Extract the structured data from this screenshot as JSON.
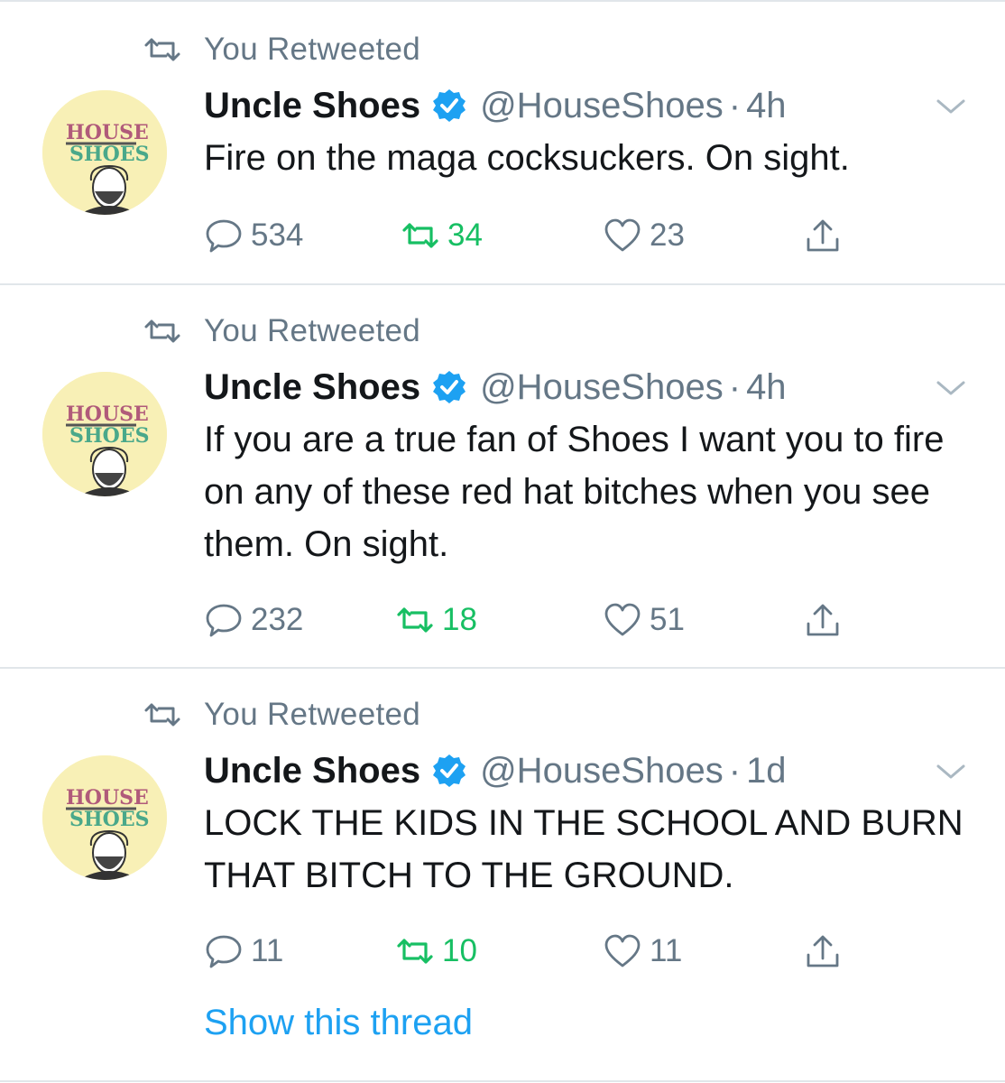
{
  "colors": {
    "retweet_active": "#17bf63",
    "link": "#1da1f2",
    "secondary_text": "#657786",
    "verified_badge": "#1da1f2",
    "divider": "#e1e6ea"
  },
  "tweets": [
    {
      "retweet_label": "You Retweeted",
      "author_name": "Uncle Shoes",
      "handle": "@HouseShoes",
      "separator": "·",
      "time": "4h",
      "text": "Fire on the maga cocksuckers. On sight.",
      "replies": "534",
      "retweets": "34",
      "likes": "23",
      "avatar_text_line1": "HOUSE",
      "avatar_text_line2": "SHOES"
    },
    {
      "retweet_label": "You Retweeted",
      "author_name": "Uncle Shoes",
      "handle": "@HouseShoes",
      "separator": "·",
      "time": "4h",
      "text": "If you are a true fan of Shoes I want you to fire on any of these red hat bitches when you see them. On sight.",
      "replies": "232",
      "retweets": "18",
      "likes": "51",
      "avatar_text_line1": "HOUSE",
      "avatar_text_line2": "SHOES"
    },
    {
      "retweet_label": "You Retweeted",
      "author_name": "Uncle Shoes",
      "handle": "@HouseShoes",
      "separator": "·",
      "time": "1d",
      "text": "LOCK THE KIDS IN THE SCHOOL AND BURN THAT BITCH TO THE GROUND.",
      "replies": "11",
      "retweets": "10",
      "likes": "11",
      "avatar_text_line1": "HOUSE",
      "avatar_text_line2": "SHOES",
      "show_thread": "Show this thread"
    }
  ],
  "icons": {
    "retweet_header": "retweet-icon",
    "verified": "verified-badge-icon",
    "caret": "chevron-down-icon",
    "reply": "reply-icon",
    "retweet": "retweet-icon",
    "like": "heart-icon",
    "share": "share-icon"
  }
}
